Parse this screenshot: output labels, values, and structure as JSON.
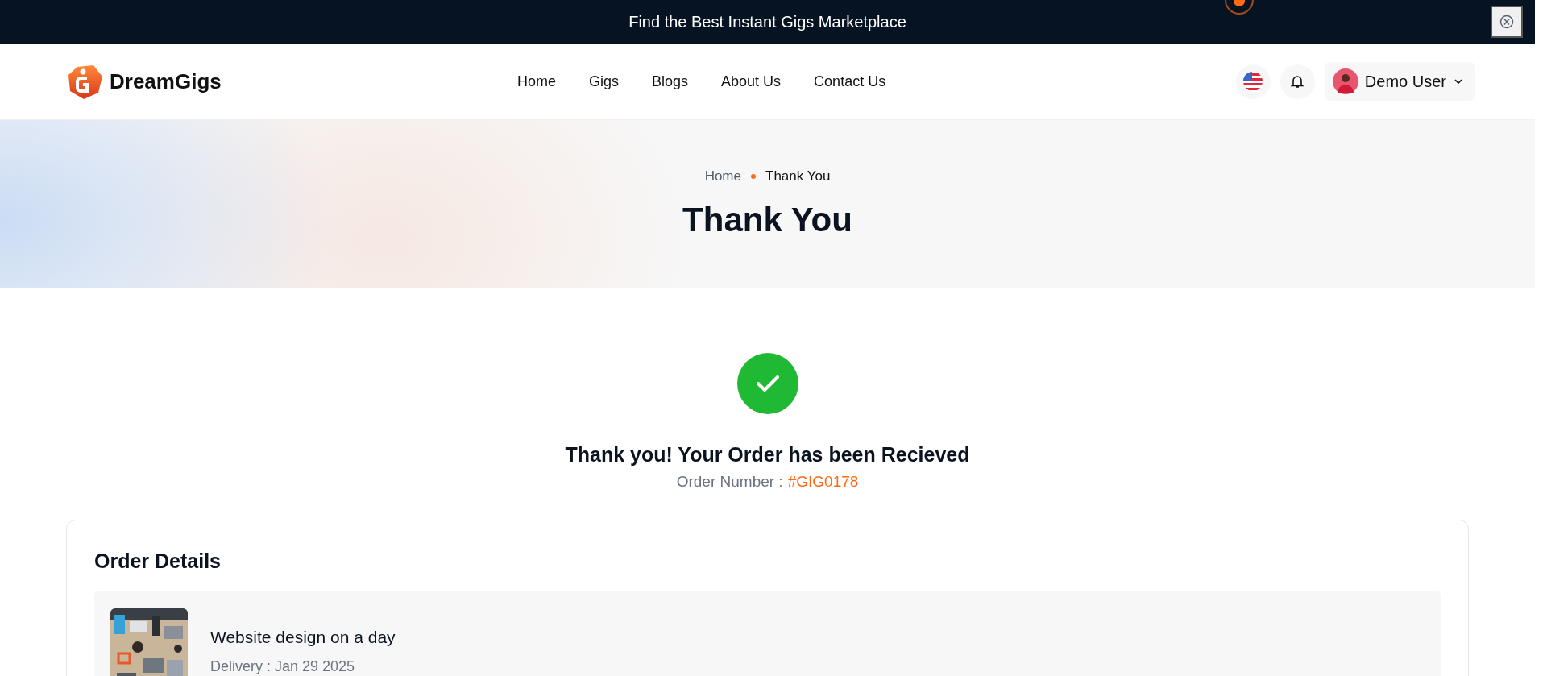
{
  "announcement": {
    "text": "Find the Best Instant Gigs Marketplace"
  },
  "header": {
    "logo": "DreamGigs",
    "nav": [
      {
        "label": "Home",
        "selected": false
      },
      {
        "label": "Gigs",
        "selected": false
      },
      {
        "label": "Blogs",
        "selected": false
      },
      {
        "label": "About Us",
        "selected": false
      },
      {
        "label": "Contact Us",
        "selected": false
      }
    ],
    "user": "Demo User"
  },
  "breadcrumb": [
    "Home",
    "Thank You"
  ],
  "page_title": "Thank You",
  "confirmation": {
    "heading": "Thank you! Your Order has been Recieved",
    "order_label": "Order Number :",
    "order_number": "#GIG0178"
  },
  "order_details": {
    "title": "Order Details",
    "items": [
      {
        "kind": "picture",
        "title": "Website design on a day",
        "delivery": "Delivery : Jan 29 2025"
      }
    ]
  }
}
